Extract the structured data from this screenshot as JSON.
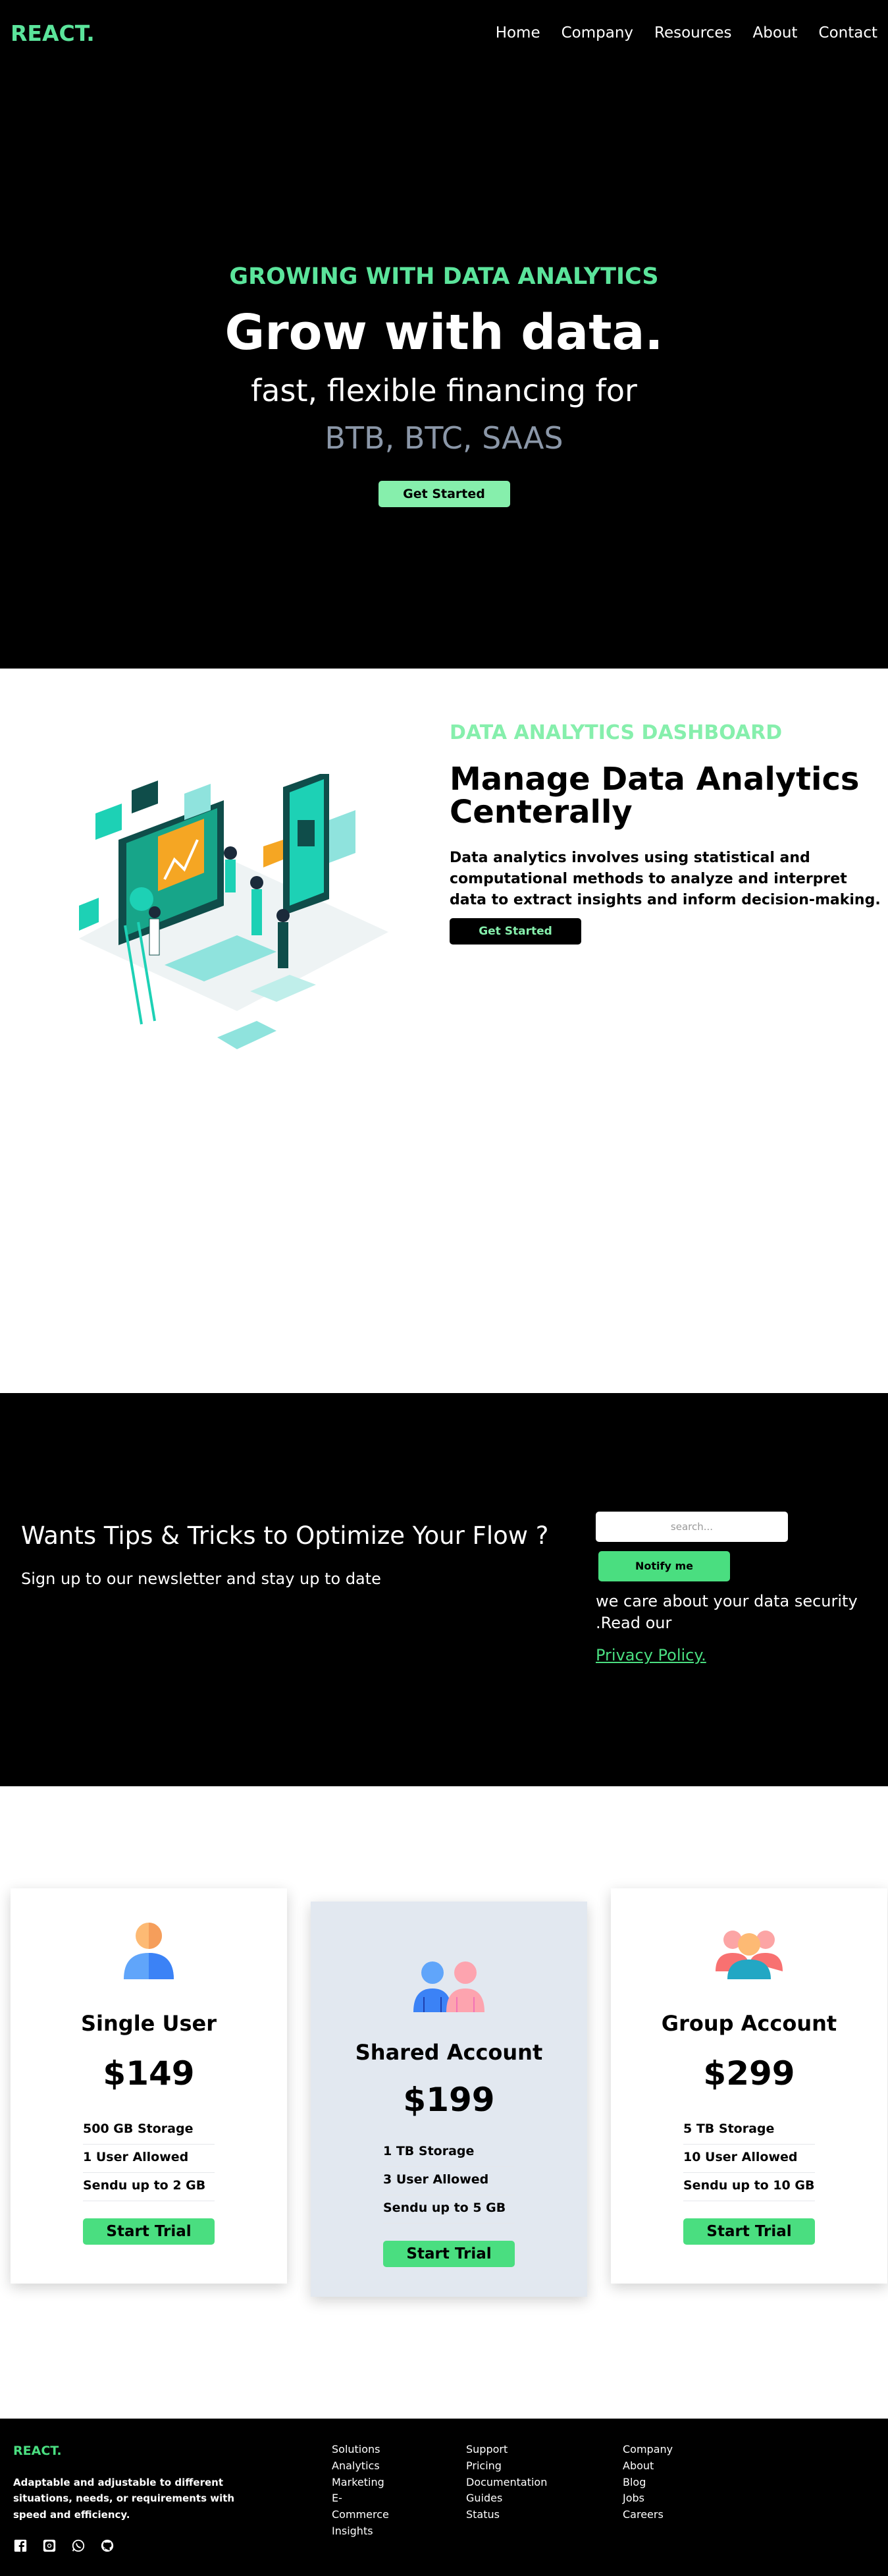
{
  "header": {
    "logo": "REACT.",
    "nav": [
      "Home",
      "Company",
      "Resources",
      "About",
      "Contact"
    ]
  },
  "hero": {
    "kicker": "GROWING WITH DATA ANALYTICS",
    "title": "Grow with data.",
    "subtitle_line1": "fast, flexible financing for",
    "subtitle_line2": "BTB, BTC, SAAS",
    "cta": "Get Started"
  },
  "analytics": {
    "kicker": "DATA ANALYTICS DASHBOARD",
    "title": "Manage Data Analytics Centerally",
    "body": "Data analytics involves using statistical and computational methods to analyze and interpret data to extract insights and inform decision-making.",
    "cta": "Get Started"
  },
  "newsletter": {
    "title": "Wants Tips & Tricks to Optimize Your Flow ?",
    "subtitle": "Sign up to our newsletter and stay up to date",
    "placeholder": "search...",
    "button": "Notify me",
    "note": "we care about your data security .Read our",
    "policy": "Privacy Policy."
  },
  "pricing": {
    "plans": [
      {
        "name": "Single User",
        "price": "$149",
        "features": [
          "500 GB Storage",
          "1 User Allowed",
          "Sendu up to 2 GB"
        ],
        "cta": "Start Trial"
      },
      {
        "name": "Shared Account",
        "price": "$199",
        "features": [
          "1 TB Storage",
          "3 User Allowed",
          "Sendu up to 5 GB"
        ],
        "cta": "Start Trial"
      },
      {
        "name": "Group Account",
        "price": "$299",
        "features": [
          "5 TB Storage",
          "10 User Allowed",
          "Sendu up to 10 GB"
        ],
        "cta": "Start Trial"
      }
    ]
  },
  "footer": {
    "logo": "REACT.",
    "tagline": "Adaptable and adjustable to different situations, needs, or requirements with speed and efficiency.",
    "col_solutions": [
      "Solutions",
      "Analytics",
      "Marketing",
      "E-",
      "Commerce",
      "Insights"
    ],
    "col_support": [
      "Support",
      "Pricing",
      "Documentation",
      "Guides",
      "Status"
    ],
    "col_company": [
      "Company",
      "About",
      "Blog",
      "Jobs",
      "Careers"
    ],
    "social_icons": [
      "facebook-icon",
      "instagram-icon",
      "whatsapp-icon",
      "github-icon"
    ]
  },
  "colors": {
    "brand_green": "#5be49b",
    "button_green": "#4ade80",
    "light_green": "#86efac",
    "dark_bg": "#000000",
    "muted_gray": "#8b97a8",
    "card_highlight": "#e2e8f0"
  }
}
